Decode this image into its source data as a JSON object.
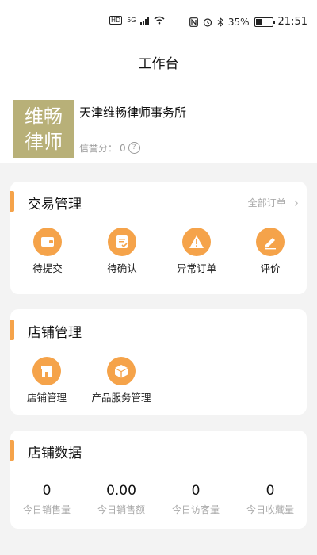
{
  "status_bar": {
    "hd": "HD",
    "network": "5G",
    "battery": "35%",
    "time": "21:51"
  },
  "header": {
    "title": "工作台"
  },
  "profile": {
    "logo_line1": "维畅",
    "logo_line2": "律师",
    "firm_name": "天津维畅律师事务所",
    "reputation_label": "信誉分：",
    "reputation_value": "0"
  },
  "trade": {
    "title": "交易管理",
    "all_orders": "全部订单",
    "items": [
      {
        "label": "待提交",
        "icon": "wallet-icon"
      },
      {
        "label": "待确认",
        "icon": "clipboard-check-icon"
      },
      {
        "label": "异常订单",
        "icon": "warning-icon"
      },
      {
        "label": "评价",
        "icon": "pencil-icon"
      }
    ]
  },
  "store": {
    "title": "店铺管理",
    "items": [
      {
        "label": "店铺管理",
        "icon": "storefront-icon"
      },
      {
        "label": "产品服务管理",
        "icon": "box-icon"
      }
    ]
  },
  "data": {
    "title": "店铺数据",
    "stats": [
      {
        "value": "0",
        "label": "今日销售量"
      },
      {
        "value": "0.00",
        "label": "今日销售额"
      },
      {
        "value": "0",
        "label": "今日访客量"
      },
      {
        "value": "0",
        "label": "今日收藏量"
      }
    ]
  },
  "colors": {
    "accent": "#f5a34a",
    "logo_bg": "#b8b078",
    "page_bg": "#f3f3f3"
  }
}
